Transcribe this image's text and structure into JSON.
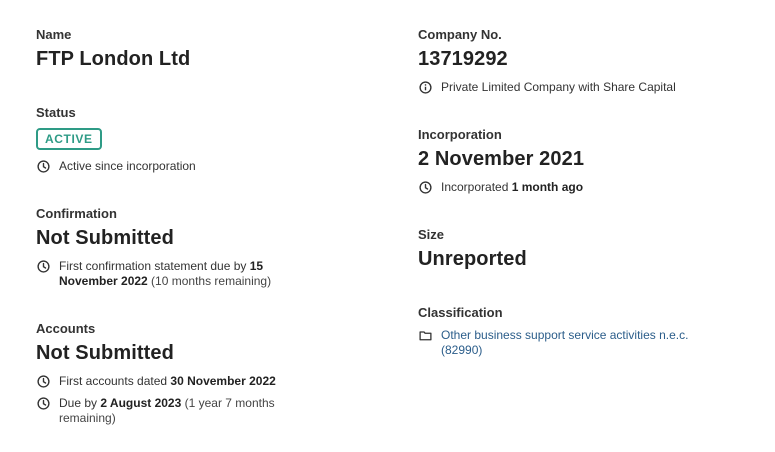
{
  "name": {
    "label": "Name",
    "value": "FTP London Ltd"
  },
  "status": {
    "label": "Status",
    "badge": "ACTIVE",
    "note": "Active since incorporation"
  },
  "confirmation": {
    "label": "Confirmation",
    "value": "Not Submitted",
    "note_prefix": "First confirmation statement due by ",
    "note_date": "15 November 2022",
    "note_suffix": " (10 months remaining)"
  },
  "accounts": {
    "label": "Accounts",
    "value": "Not Submitted",
    "note1_prefix": "First accounts dated ",
    "note1_date": "30 November 2022",
    "note2_prefix": "Due by ",
    "note2_date": "2 August 2023",
    "note2_suffix": " (1 year 7 months remaining)"
  },
  "company_no": {
    "label": "Company No.",
    "value": "13719292",
    "note": "Private Limited Company with Share Capital"
  },
  "incorporation": {
    "label": "Incorporation",
    "value": "2 November 2021",
    "note_prefix": "Incorporated ",
    "note_bold": "1 month ago"
  },
  "size": {
    "label": "Size",
    "value": "Unreported"
  },
  "classification": {
    "label": "Classification",
    "link": "Other business support service activities n.e.c. (82990)"
  },
  "icons": {
    "clock": "clock-icon",
    "info": "info-icon",
    "folder": "folder-icon"
  },
  "colors": {
    "badge": "#2e9b86",
    "link": "#2b5d8a"
  }
}
